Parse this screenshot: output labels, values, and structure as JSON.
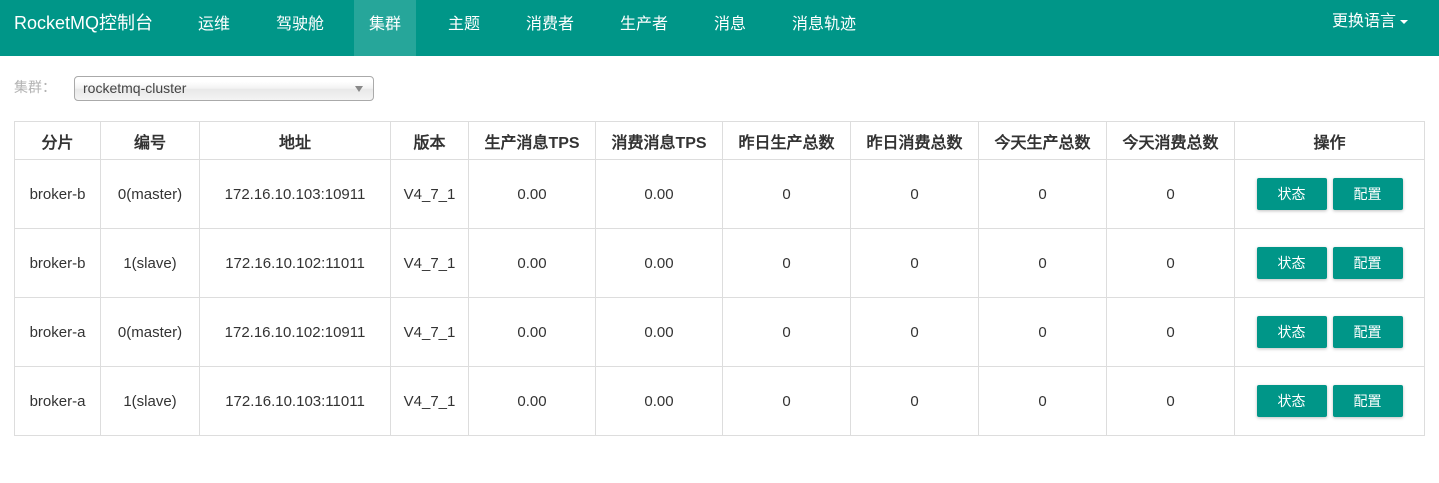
{
  "nav": {
    "brand": "RocketMQ控制台",
    "items": [
      {
        "label": "运维"
      },
      {
        "label": "驾驶舱"
      },
      {
        "label": "集群",
        "active": true
      },
      {
        "label": "主题"
      },
      {
        "label": "消费者"
      },
      {
        "label": "生产者"
      },
      {
        "label": "消息"
      },
      {
        "label": "消息轨迹"
      }
    ],
    "language": "更换语言"
  },
  "filter": {
    "label": "集群：",
    "selected": "rocketmq-cluster"
  },
  "table": {
    "headers": [
      "分片",
      "编号",
      "地址",
      "版本",
      "生产消息TPS",
      "消费消息TPS",
      "昨日生产总数",
      "昨日消费总数",
      "今天生产总数",
      "今天消费总数",
      "操作"
    ],
    "rows": [
      {
        "shard": "broker-b",
        "id": "0(master)",
        "address": "172.16.10.103:10911",
        "version": "V4_7_1",
        "produce_tps": "0.00",
        "consume_tps": "0.00",
        "yesterday_produce": "0",
        "yesterday_consume": "0",
        "today_produce": "0",
        "today_consume": "0"
      },
      {
        "shard": "broker-b",
        "id": "1(slave)",
        "address": "172.16.10.102:11011",
        "version": "V4_7_1",
        "produce_tps": "0.00",
        "consume_tps": "0.00",
        "yesterday_produce": "0",
        "yesterday_consume": "0",
        "today_produce": "0",
        "today_consume": "0"
      },
      {
        "shard": "broker-a",
        "id": "0(master)",
        "address": "172.16.10.102:10911",
        "version": "V4_7_1",
        "produce_tps": "0.00",
        "consume_tps": "0.00",
        "yesterday_produce": "0",
        "yesterday_consume": "0",
        "today_produce": "0",
        "today_consume": "0"
      },
      {
        "shard": "broker-a",
        "id": "1(slave)",
        "address": "172.16.10.103:11011",
        "version": "V4_7_1",
        "produce_tps": "0.00",
        "consume_tps": "0.00",
        "yesterday_produce": "0",
        "yesterday_consume": "0",
        "today_produce": "0",
        "today_consume": "0"
      }
    ],
    "actions": {
      "status": "状态",
      "config": "配置"
    }
  },
  "colors": {
    "primary": "#009688",
    "active_tab": "#26a69a",
    "border": "#dddddd"
  }
}
